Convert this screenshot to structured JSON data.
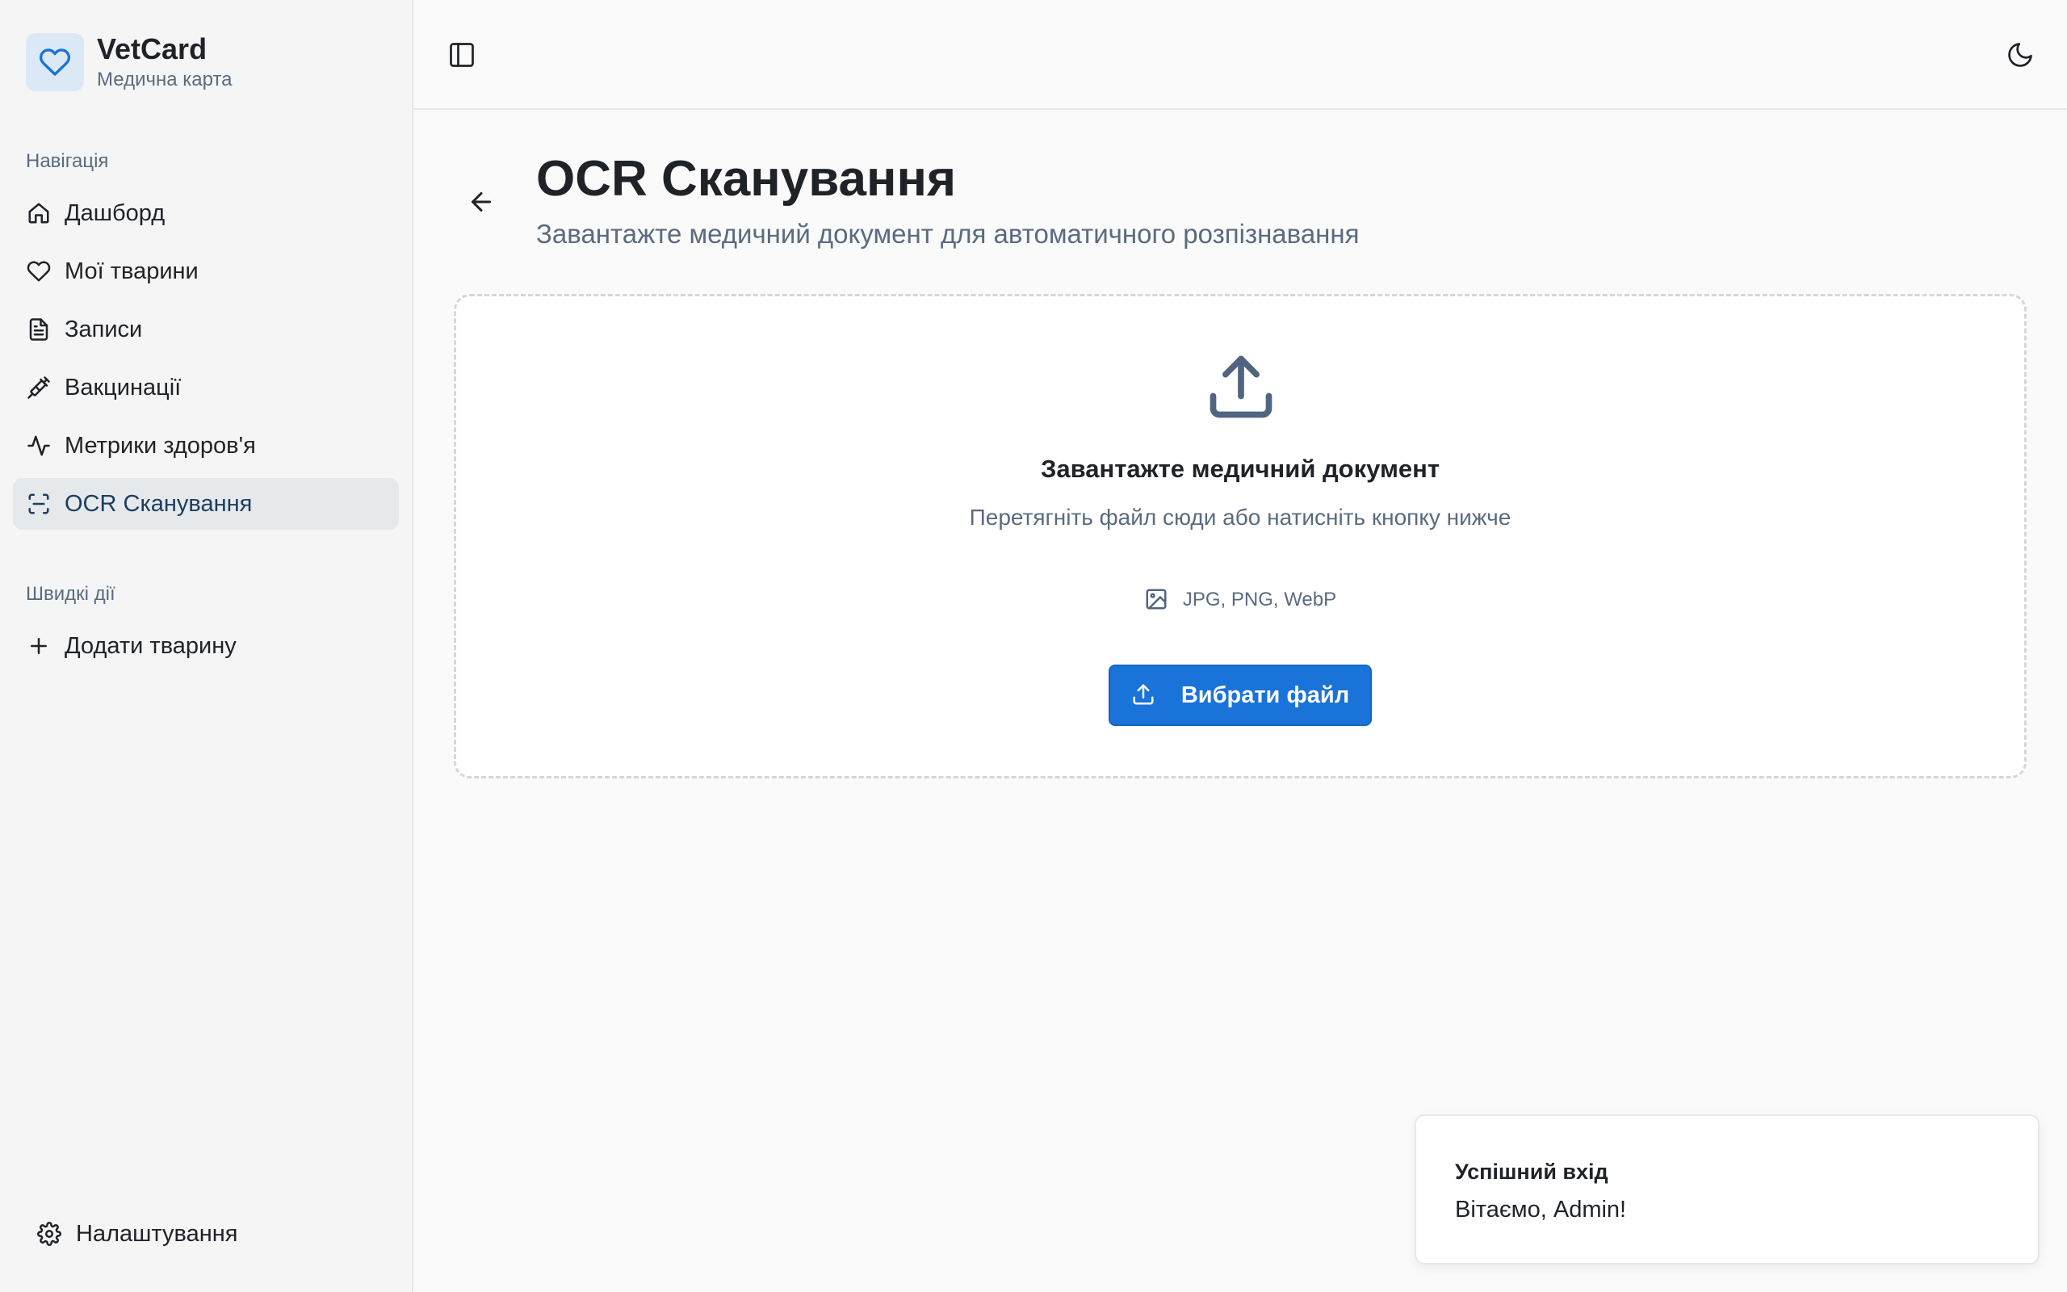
{
  "brand": {
    "title": "VetCard",
    "subtitle": "Медична карта",
    "icon": "heart-icon",
    "accent": "#1a73d9"
  },
  "sidebar": {
    "nav_label": "Навігація",
    "items": [
      {
        "label": "Дашборд",
        "icon": "home-icon",
        "active": false
      },
      {
        "label": "Мої тварини",
        "icon": "heart-icon",
        "active": false
      },
      {
        "label": "Записи",
        "icon": "file-text-icon",
        "active": false
      },
      {
        "label": "Вакцинації",
        "icon": "syringe-icon",
        "active": false
      },
      {
        "label": "Метрики здоров'я",
        "icon": "activity-icon",
        "active": false
      },
      {
        "label": "OCR Сканування",
        "icon": "scan-icon",
        "active": true
      }
    ],
    "quick_label": "Швидкі дії",
    "quick_items": [
      {
        "label": "Додати тварину",
        "icon": "plus-icon"
      }
    ],
    "settings_label": "Налаштування"
  },
  "topbar": {
    "toggle_icon": "sidebar-toggle-icon",
    "theme_icon": "moon-icon"
  },
  "page": {
    "title": "OCR Сканування",
    "subtitle": "Завантажте медичний документ для автоматичного розпізнавання"
  },
  "upload": {
    "title": "Завантажте медичний документ",
    "hint": "Перетягніть файл сюди або натисніть кнопку нижче",
    "formats": "JPG, PNG, WebP",
    "button_label": "Вибрати файл"
  },
  "toast": {
    "title": "Успішний вхід",
    "message": "Вітаємо, Admin!"
  }
}
